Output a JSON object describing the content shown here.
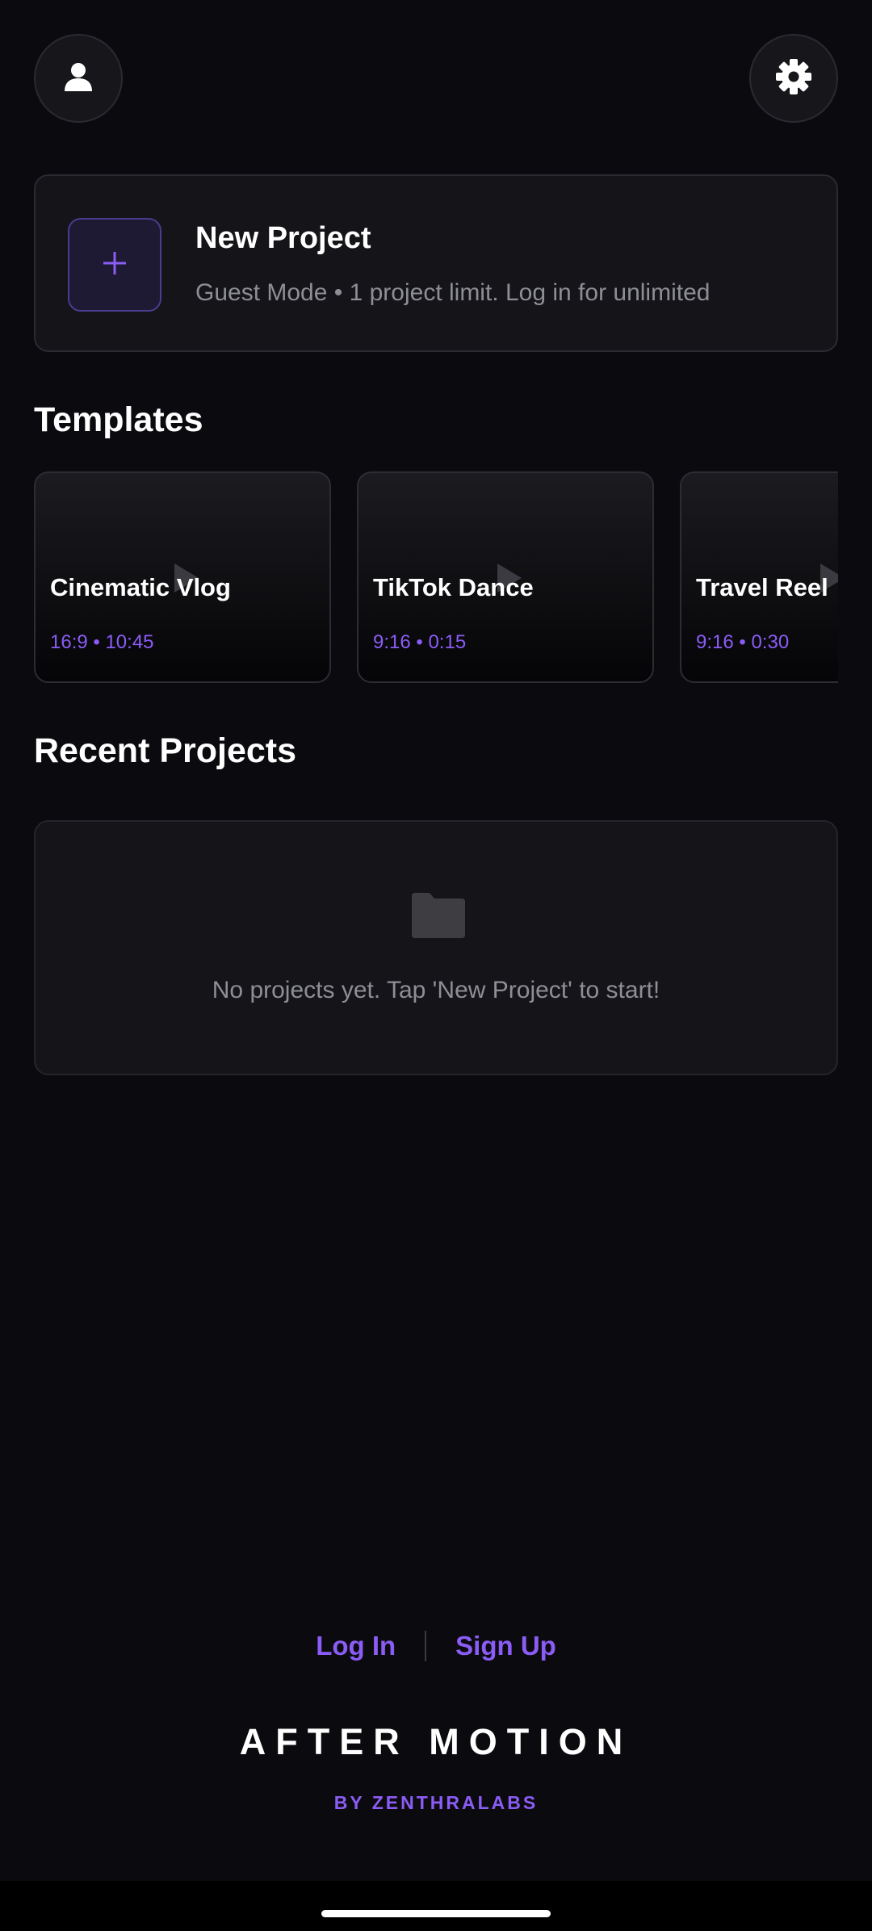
{
  "header": {
    "profile_icon": "person-icon",
    "settings_icon": "gear-icon"
  },
  "new_project": {
    "title": "New Project",
    "subtitle": "Guest Mode • 1 project limit. Log in for unlimited",
    "icon": "plus-icon"
  },
  "templates": {
    "title": "Templates",
    "items": [
      {
        "name": "Cinematic Vlog",
        "meta": "16:9 • 10:45"
      },
      {
        "name": "TikTok Dance",
        "meta": "9:16 • 0:15"
      },
      {
        "name": "Travel Reel",
        "meta": "9:16 • 0:30"
      }
    ]
  },
  "recent": {
    "title": "Recent Projects",
    "empty_icon": "folder-icon",
    "empty_text": "No projects yet. Tap 'New Project' to start!"
  },
  "auth": {
    "login_label": "Log In",
    "signup_label": "Sign Up"
  },
  "brand": {
    "name": "AFTER MOTION",
    "byline": "BY ZENTHRALABS"
  },
  "colors": {
    "background": "#0b0b0f",
    "accent": "#8b5cf6",
    "card": "#141419"
  }
}
